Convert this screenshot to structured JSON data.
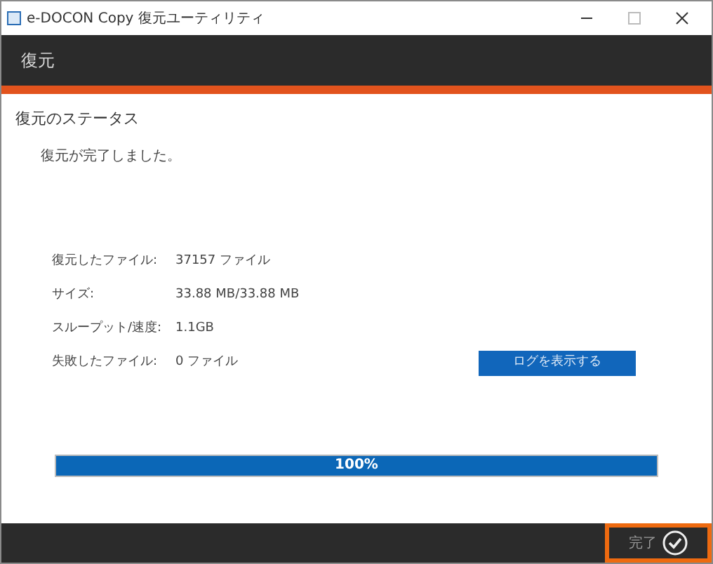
{
  "window": {
    "title": "e-DOCON Copy 復元ユーティリティ"
  },
  "header": {
    "title": "復元"
  },
  "status": {
    "heading": "復元のステータス",
    "message": "復元が完了しました。",
    "fields": [
      {
        "label": "復元したファイル:",
        "value": "37157 ファイル"
      },
      {
        "label": "サイズ:",
        "value": "33.88 MB/33.88 MB"
      },
      {
        "label": "スループット/速度:",
        "value": "1.1GB"
      },
      {
        "label": "失敗したファイル:",
        "value": "0 ファイル"
      }
    ],
    "log_button": "ログを表示する"
  },
  "progress": {
    "level": 1,
    "label": "100%"
  },
  "footer": {
    "finish_button": "完了"
  }
}
